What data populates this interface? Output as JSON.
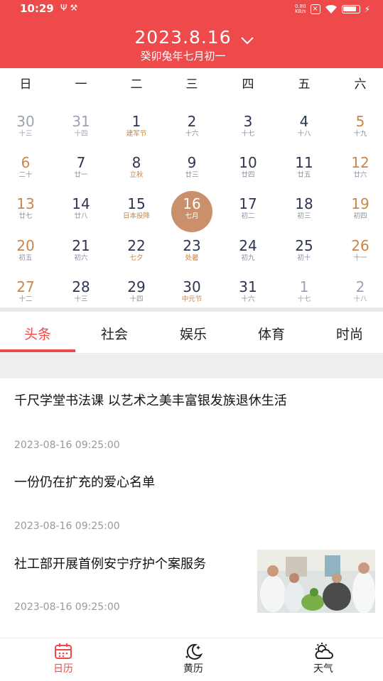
{
  "status_bar": {
    "time": "10:29",
    "icons": [
      "usb-icon",
      "tools-icon"
    ],
    "net_speed_value": "0.80",
    "net_speed_unit": "KB/s"
  },
  "header": {
    "date": "2023.8.16",
    "lunar": "癸卯兔年七月初一",
    "bg_color": "#ef4a4b"
  },
  "weekdays": [
    "日",
    "一",
    "二",
    "三",
    "四",
    "五",
    "六"
  ],
  "calendar": {
    "selected_color": "#c9906b",
    "weeks": [
      [
        {
          "d": "30",
          "s": "十三",
          "type": "out"
        },
        {
          "d": "31",
          "s": "十四",
          "type": "out"
        },
        {
          "d": "1",
          "s": "建军节",
          "type": "fest"
        },
        {
          "d": "2",
          "s": "十六",
          "type": "norm"
        },
        {
          "d": "3",
          "s": "十七",
          "type": "norm"
        },
        {
          "d": "4",
          "s": "十八",
          "type": "norm"
        },
        {
          "d": "5",
          "s": "十九",
          "type": "wknd"
        }
      ],
      [
        {
          "d": "6",
          "s": "二十",
          "type": "wknd"
        },
        {
          "d": "7",
          "s": "廿一",
          "type": "norm"
        },
        {
          "d": "8",
          "s": "立秋",
          "type": "fest"
        },
        {
          "d": "9",
          "s": "廿三",
          "type": "norm"
        },
        {
          "d": "10",
          "s": "廿四",
          "type": "norm"
        },
        {
          "d": "11",
          "s": "廿五",
          "type": "norm"
        },
        {
          "d": "12",
          "s": "廿六",
          "type": "wknd"
        }
      ],
      [
        {
          "d": "13",
          "s": "廿七",
          "type": "wknd"
        },
        {
          "d": "14",
          "s": "廿八",
          "type": "norm"
        },
        {
          "d": "15",
          "s": "日本投降",
          "type": "fest"
        },
        {
          "d": "16",
          "s": "七月",
          "type": "sel"
        },
        {
          "d": "17",
          "s": "初二",
          "type": "norm"
        },
        {
          "d": "18",
          "s": "初三",
          "type": "norm"
        },
        {
          "d": "19",
          "s": "初四",
          "type": "wknd"
        }
      ],
      [
        {
          "d": "20",
          "s": "初五",
          "type": "wknd"
        },
        {
          "d": "21",
          "s": "初六",
          "type": "norm"
        },
        {
          "d": "22",
          "s": "七夕",
          "type": "fest"
        },
        {
          "d": "23",
          "s": "处暑",
          "type": "fest"
        },
        {
          "d": "24",
          "s": "初九",
          "type": "norm"
        },
        {
          "d": "25",
          "s": "初十",
          "type": "norm"
        },
        {
          "d": "26",
          "s": "十一",
          "type": "wknd"
        }
      ],
      [
        {
          "d": "27",
          "s": "十二",
          "type": "wknd"
        },
        {
          "d": "28",
          "s": "十三",
          "type": "norm"
        },
        {
          "d": "29",
          "s": "十四",
          "type": "norm"
        },
        {
          "d": "30",
          "s": "中元节",
          "type": "fest"
        },
        {
          "d": "31",
          "s": "十六",
          "type": "norm"
        },
        {
          "d": "1",
          "s": "十七",
          "type": "out"
        },
        {
          "d": "2",
          "s": "十八",
          "type": "out"
        }
      ]
    ]
  },
  "tabs": [
    {
      "label": "头条",
      "active": true
    },
    {
      "label": "社会",
      "active": false
    },
    {
      "label": "娱乐",
      "active": false
    },
    {
      "label": "体育",
      "active": false
    },
    {
      "label": "时尚",
      "active": false
    }
  ],
  "news": [
    {
      "title": "千尺学堂书法课 以艺术之美丰富银发族退休生活",
      "time": "2023-08-16 09:25:00"
    },
    {
      "title": "一份仍在扩充的爱心名单",
      "time": "2023-08-16 09:25:00"
    },
    {
      "title": "社工部开展首例安宁疗护个案服务",
      "time": "2023-08-16 09:25:00",
      "has_image": true
    }
  ],
  "bottom_nav": [
    {
      "label": "日历",
      "icon": "calendar-icon",
      "active": true
    },
    {
      "label": "黄历",
      "icon": "moon-icon",
      "active": false
    },
    {
      "label": "天气",
      "icon": "weather-icon",
      "active": false
    }
  ]
}
